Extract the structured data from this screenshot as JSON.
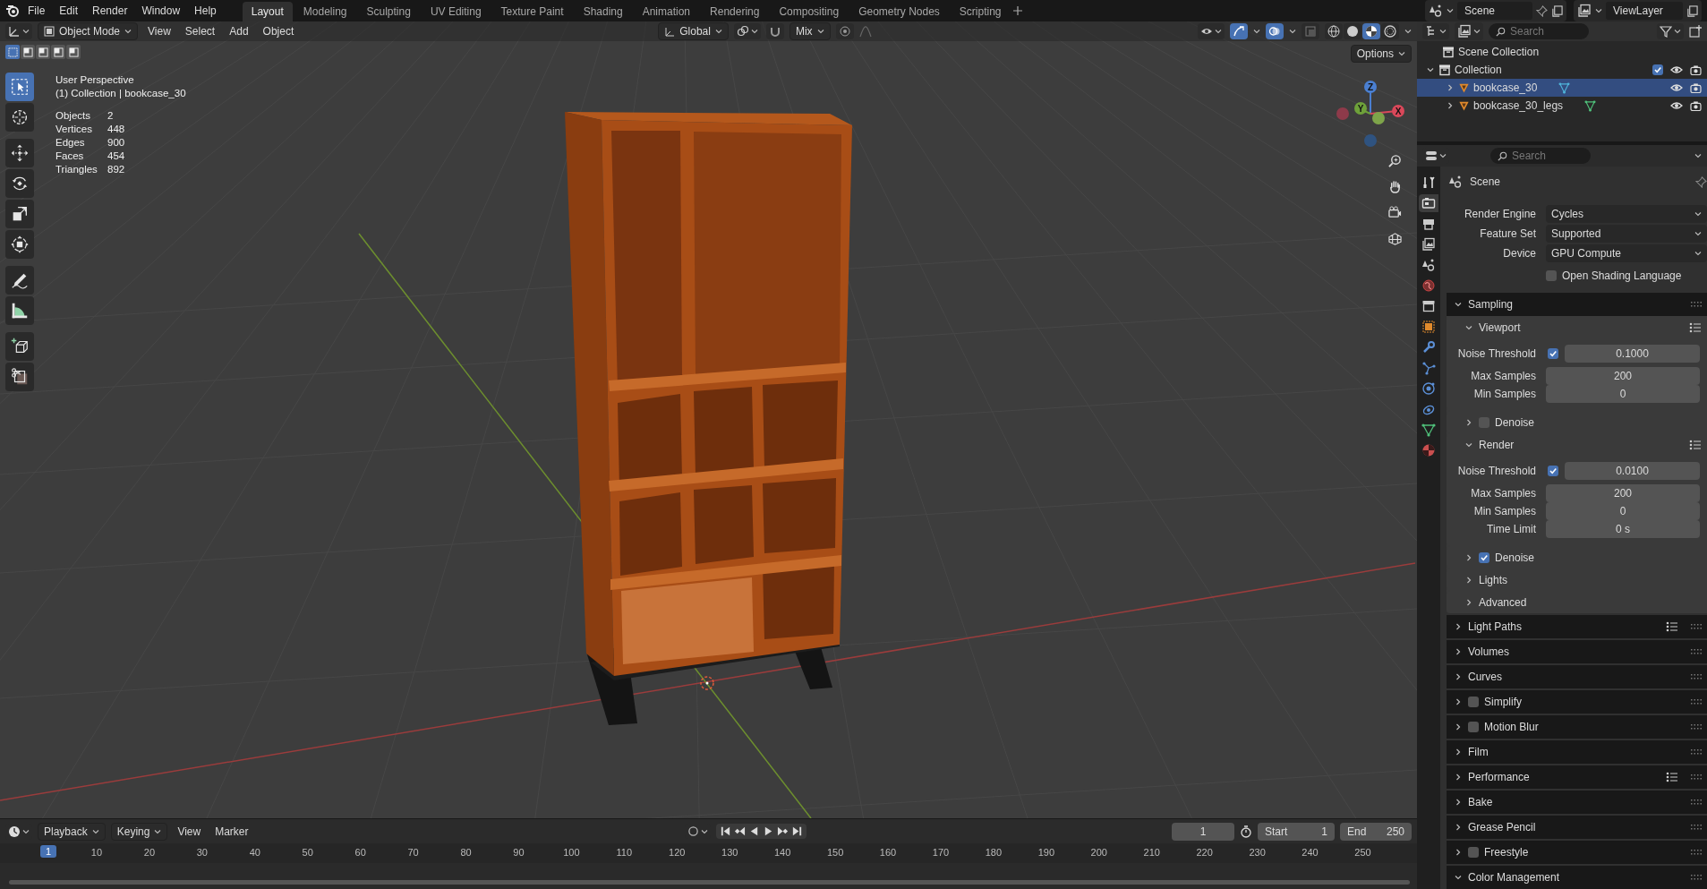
{
  "top_menu": [
    "File",
    "Edit",
    "Render",
    "Window",
    "Help"
  ],
  "workspaces": [
    {
      "label": "Layout",
      "selected": true
    },
    {
      "label": "Modeling",
      "selected": false
    },
    {
      "label": "Sculpting",
      "selected": false
    },
    {
      "label": "UV Editing",
      "selected": false
    },
    {
      "label": "Texture Paint",
      "selected": false
    },
    {
      "label": "Shading",
      "selected": false
    },
    {
      "label": "Animation",
      "selected": false
    },
    {
      "label": "Rendering",
      "selected": false
    },
    {
      "label": "Compositing",
      "selected": false
    },
    {
      "label": "Geometry Nodes",
      "selected": false
    },
    {
      "label": "Scripting",
      "selected": false
    }
  ],
  "scene": "Scene",
  "view_layer": "ViewLayer",
  "viewport": {
    "mode": "Object Mode",
    "menus": [
      "View",
      "Select",
      "Add",
      "Object"
    ],
    "orientation": "Global",
    "blend": "Mix",
    "options": "Options",
    "select_modes": [
      {
        "selected": true
      },
      {
        "selected": false
      },
      {
        "selected": false
      },
      {
        "selected": false
      },
      {
        "selected": false
      }
    ],
    "shading": [
      {
        "kind": "wireframe",
        "selected": false
      },
      {
        "kind": "solid",
        "selected": false
      },
      {
        "kind": "material",
        "selected": true
      },
      {
        "kind": "rendered",
        "selected": false
      }
    ],
    "tools": [
      {
        "kind": "select",
        "selected": true
      },
      {
        "kind": "cursor",
        "selected": false
      },
      {
        "kind": "move",
        "selected": false
      },
      {
        "kind": "rotate",
        "selected": false
      },
      {
        "kind": "scale",
        "selected": false
      },
      {
        "kind": "transform",
        "selected": false
      },
      {
        "kind": "annotate",
        "selected": false
      },
      {
        "kind": "measure",
        "selected": false
      },
      {
        "kind": "add_cube",
        "selected": false
      },
      {
        "kind": "cut",
        "selected": false
      }
    ],
    "info": {
      "view": "User Perspective",
      "context": "(1) Collection | bookcase_30",
      "stats": [
        {
          "label": "Objects",
          "value": "2"
        },
        {
          "label": "Vertices",
          "value": "448"
        },
        {
          "label": "Edges",
          "value": "900"
        },
        {
          "label": "Faces",
          "value": "454"
        },
        {
          "label": "Triangles",
          "value": "892"
        }
      ]
    },
    "gizmo": {
      "x": "X",
      "y": "Y",
      "z": "Z"
    }
  },
  "outliner": {
    "search": {
      "placeholder": "Search"
    },
    "root": "Scene Collection",
    "tree": [
      {
        "label": "Collection",
        "checked": true,
        "expanded": true,
        "children": [
          {
            "label": "bookcase_30",
            "selected": true,
            "expanded": false
          },
          {
            "label": "bookcase_30_legs",
            "selected": false,
            "expanded": false
          }
        ]
      }
    ]
  },
  "properties": {
    "search": {
      "placeholder": "Search"
    },
    "tabs": [
      {
        "kind": "tool",
        "selected": false
      },
      {
        "kind": "render",
        "selected": true
      },
      {
        "kind": "output",
        "selected": false
      },
      {
        "kind": "view_layer",
        "selected": false
      },
      {
        "kind": "scene",
        "selected": false
      },
      {
        "kind": "world",
        "selected": false
      },
      {
        "kind": "collection",
        "selected": false
      },
      {
        "kind": "object",
        "selected": false
      },
      {
        "kind": "modifier",
        "selected": false
      },
      {
        "kind": "particles",
        "selected": false
      },
      {
        "kind": "physics",
        "selected": false
      },
      {
        "kind": "constraints",
        "selected": false
      },
      {
        "kind": "data",
        "selected": false
      },
      {
        "kind": "material",
        "selected": false
      }
    ],
    "context": "Scene",
    "fields": [
      {
        "label": "Render Engine",
        "value": "Cycles"
      },
      {
        "label": "Feature Set",
        "value": "Supported"
      },
      {
        "label": "Device",
        "value": "GPU Compute"
      }
    ],
    "osl": {
      "label": "Open Shading Language",
      "checked": false
    },
    "panels": [
      {
        "label": "Sampling",
        "expanded": true,
        "presets": false,
        "children": [
          {
            "label": "Viewport",
            "expanded": true,
            "presets": true,
            "rows": [
              {
                "kind": "check_number",
                "label": "Noise Threshold",
                "checked": true,
                "value": "0.1000"
              },
              {
                "kind": "number",
                "label": "Max Samples",
                "value": "200"
              },
              {
                "kind": "number",
                "label": "Min Samples",
                "value": "0"
              }
            ]
          },
          {
            "label": "Denoise",
            "expanded": false,
            "presets": false,
            "checked": false
          },
          {
            "label": "Render",
            "expanded": true,
            "presets": true,
            "rows": [
              {
                "kind": "check_number",
                "label": "Noise Threshold",
                "checked": true,
                "value": "0.0100"
              },
              {
                "kind": "number",
                "label": "Max Samples",
                "value": "200"
              },
              {
                "kind": "number",
                "label": "Min Samples",
                "value": "0"
              },
              {
                "kind": "number",
                "label": "Time Limit",
                "value": "0 s"
              }
            ]
          },
          {
            "label": "Denoise",
            "expanded": false,
            "presets": false,
            "checked": true
          },
          {
            "label": "Lights",
            "expanded": false,
            "presets": false
          },
          {
            "label": "Advanced",
            "expanded": false,
            "presets": false
          }
        ]
      },
      {
        "label": "Light Paths",
        "expanded": false,
        "presets": true
      },
      {
        "label": "Volumes",
        "expanded": false,
        "presets": false
      },
      {
        "label": "Curves",
        "expanded": false,
        "presets": false
      },
      {
        "label": "Simplify",
        "expanded": false,
        "presets": false,
        "checked": false
      },
      {
        "label": "Motion Blur",
        "expanded": false,
        "presets": false,
        "checked": false
      },
      {
        "label": "Film",
        "expanded": false,
        "presets": false
      },
      {
        "label": "Performance",
        "expanded": false,
        "presets": true
      },
      {
        "label": "Bake",
        "expanded": false,
        "presets": false
      },
      {
        "label": "Grease Pencil",
        "expanded": false,
        "presets": false
      },
      {
        "label": "Freestyle",
        "expanded": false,
        "presets": false,
        "checked": false
      },
      {
        "label": "Color Management",
        "expanded": true,
        "presets": false
      }
    ]
  },
  "timeline": {
    "menus": [
      "Playback",
      "Keying",
      "View",
      "Marker"
    ],
    "current_frame": "1",
    "start": {
      "label": "Start",
      "value": "1"
    },
    "end": {
      "label": "End",
      "value": "250"
    },
    "playhead": "1",
    "ticks": [
      "10",
      "20",
      "30",
      "40",
      "50",
      "60",
      "70",
      "80",
      "90",
      "100",
      "110",
      "120",
      "130",
      "140",
      "150",
      "160",
      "170",
      "180",
      "190",
      "200",
      "210",
      "220",
      "230",
      "240",
      "250"
    ]
  }
}
